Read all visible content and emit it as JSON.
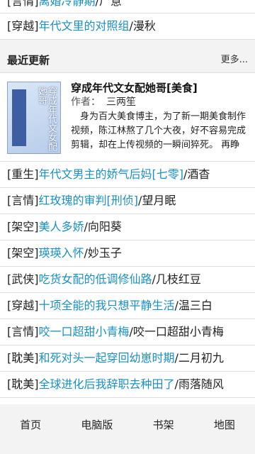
{
  "top_items": [
    {
      "tag": "[言情]",
      "title": "离婚冷静期",
      "sep": "/",
      "author": "尸意"
    },
    {
      "tag": "[穿越]",
      "title": "年代文里的对照组",
      "sep": "/",
      "author": "漫秋"
    }
  ],
  "section": {
    "title": "最近更新",
    "more": "更多..."
  },
  "featured": {
    "title": "穿成年代文女配她哥[美食]",
    "author_label": "作者：",
    "author": "三两笙",
    "description": "身为百大美食博主，为了新一期美食制作视频，陈江林熬了几个大夜，好不容易完成剪辑，却在上传视频的一瞬间猝死。 再睁",
    "cover_text": "穿成年代文女配她哥"
  },
  "list": [
    {
      "tag": "[重生]",
      "title": "年代文男主的娇气后妈[七零]",
      "sep": "/",
      "author": "酒杳"
    },
    {
      "tag": "[言情]",
      "title": "红玫瑰的审判[刑侦]",
      "sep": "/",
      "author": "望月眠"
    },
    {
      "tag": "[架空]",
      "title": "美人多娇",
      "sep": "/",
      "author": "向阳葵"
    },
    {
      "tag": "[架空]",
      "title": "瑛瑛入怀",
      "sep": "/",
      "author": "妙玉子"
    },
    {
      "tag": "[武侠]",
      "title": "吃货女配的低调修仙路",
      "sep": "/",
      "author": "几枝红豆"
    },
    {
      "tag": "[穿越]",
      "title": "十项全能的我只想平静生活",
      "sep": "/",
      "author": "温三白"
    },
    {
      "tag": "[言情]",
      "title": "咬一口超甜小青梅",
      "sep": "/",
      "author": "咬一口超甜小青梅"
    },
    {
      "tag": "[耽美]",
      "title": "和死对头一起穿回幼崽时期",
      "sep": "/",
      "author": "二月初九"
    },
    {
      "tag": "[耽美]",
      "title": "全球进化后我辞职去种田了",
      "sep": "/",
      "author": "雨落随风"
    }
  ],
  "footer": {
    "home": "首页",
    "pc": "电脑版",
    "shelf": "书架",
    "map": "地图"
  }
}
